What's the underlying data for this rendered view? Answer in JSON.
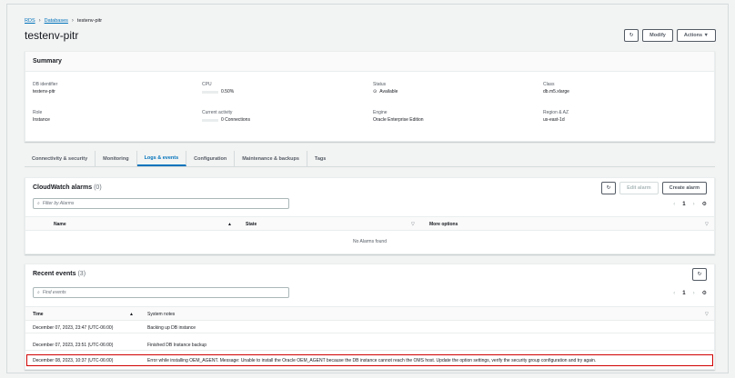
{
  "breadcrumb": [
    "RDS",
    "Databases",
    "testenv-pitr"
  ],
  "page_title": "testenv-pitr",
  "header_buttons": {
    "modify": "Modify",
    "actions": "Actions ▼"
  },
  "summary": {
    "title": "Summary",
    "db_identifier": {
      "label": "DB identifier",
      "value": "testenv-pitr"
    },
    "cpu": {
      "label": "CPU",
      "value": "0.50%",
      "progress_percent": 0.5
    },
    "status": {
      "label": "Status",
      "value": "Available"
    },
    "class": {
      "label": "Class",
      "value": "db.m5.xlarge"
    },
    "role": {
      "label": "Role",
      "value": "Instance"
    },
    "activity": {
      "label": "Current activity",
      "value": "0 Connections"
    },
    "engine": {
      "label": "Engine",
      "value": "Oracle Enterprise Edition"
    },
    "region": {
      "label": "Region & AZ",
      "value": "us-east-1d"
    }
  },
  "tabs": [
    "Connectivity & security",
    "Monitoring",
    "Logs & events",
    "Configuration",
    "Maintenance & backups",
    "Tags"
  ],
  "active_tab": "Logs & events",
  "alarms": {
    "title": "CloudWatch alarms",
    "count": "(0)",
    "edit_label": "Edit alarm",
    "create_label": "Create alarm",
    "search_placeholder": "Filter by Alarms",
    "page": "1",
    "columns": [
      "Name",
      "State",
      "More options"
    ],
    "empty": "No Alarms found"
  },
  "events": {
    "title": "Recent events",
    "count": "(3)",
    "search_placeholder": "Find events",
    "page": "1",
    "columns": [
      "Time",
      "System notes"
    ],
    "rows": [
      {
        "time": "December 07, 2023, 23:47 (UTC-06:00)",
        "note": "Backing up DB instance"
      },
      {
        "time": "December 07, 2023, 23:51 (UTC-06:00)",
        "note": "Finished DB Instance backup"
      },
      {
        "time": "December 08, 2023, 10:37 (UTC-06:00)",
        "note": "Error while installing OEM_AGENT. Message: Unable to install the Oracle OEM_AGENT because the DB instance cannot reach the OMS host. Update the option settings, verify the security group configuration and try again."
      }
    ]
  },
  "colors": {
    "accent": "#0073bb",
    "success": "#1d8102",
    "highlight": "#d00000"
  }
}
